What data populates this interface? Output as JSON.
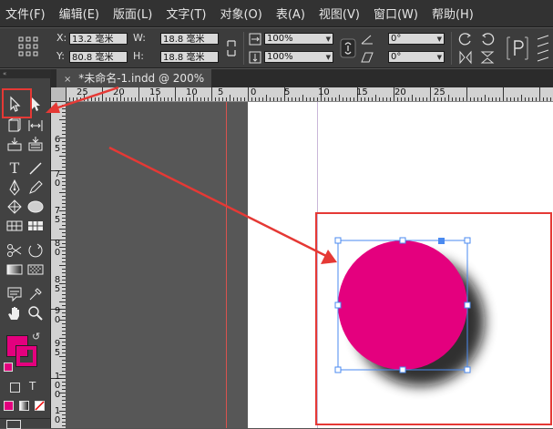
{
  "menubar": {
    "items": [
      "文件(F)",
      "编辑(E)",
      "版面(L)",
      "文字(T)",
      "对象(O)",
      "表(A)",
      "视图(V)",
      "窗口(W)",
      "帮助(H)"
    ]
  },
  "control_bar": {
    "x_label": "X:",
    "x_value": "13.2 毫米",
    "y_label": "Y:",
    "y_value": "80.8 毫米",
    "w_label": "W:",
    "w_value": "18.8 毫米",
    "h_label": "H:",
    "h_value": "18.8 毫米",
    "scale_x": "100%",
    "scale_y": "100%",
    "rotate_angle": "0°",
    "shear_angle": "0°"
  },
  "document_tab": {
    "close_glyph": "×",
    "title": "*未命名-1.indd @ 200%"
  },
  "h_ruler_labels": [
    "25",
    "20",
    "15",
    "10",
    "5",
    "0",
    "5",
    "10",
    "15",
    "20",
    "25"
  ],
  "v_ruler_labels": [
    "6",
    "5",
    "7",
    "0",
    "7",
    "5",
    "8",
    "0",
    "8",
    "5",
    "9",
    "0",
    "9",
    "5",
    "1",
    "0",
    "0",
    "1",
    "0"
  ],
  "colors": {
    "fill": "#e4007e",
    "stroke": "#e4007e",
    "selection": "#4a8af0",
    "annotation": "#e53935"
  },
  "icons": {
    "selection_tool": "selection-arrow-icon",
    "direct_selection_tool": "direct-selection-arrow-icon",
    "type_tool": "type-icon",
    "hand_tool": "hand-icon",
    "zoom_tool": "zoom-icon"
  }
}
